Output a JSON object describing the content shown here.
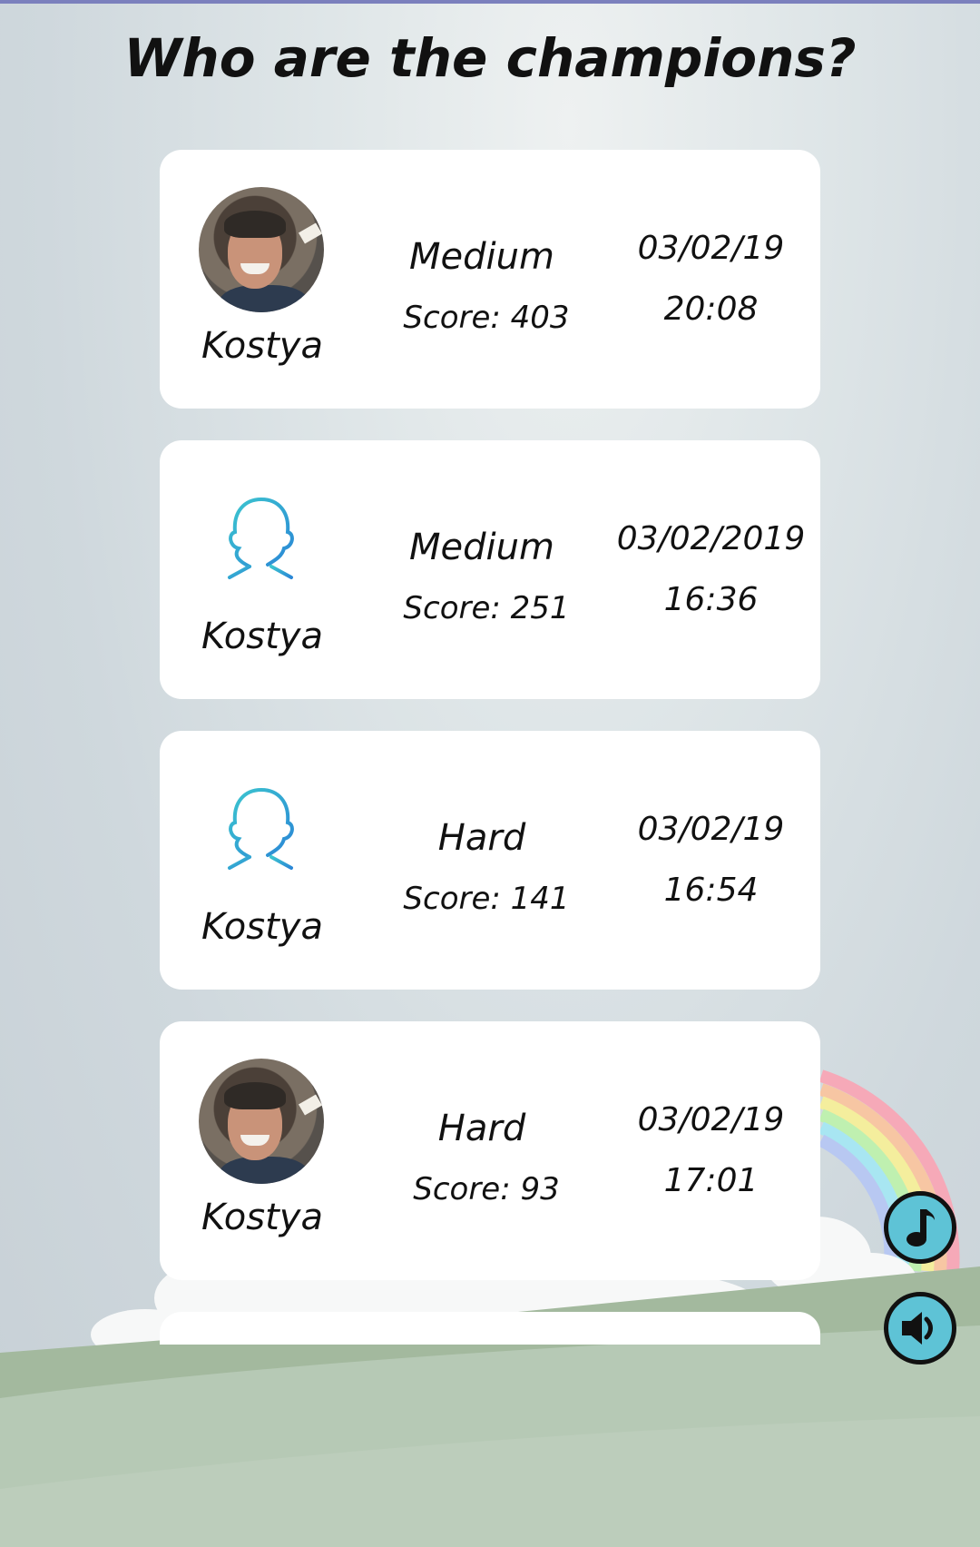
{
  "title": "Who are the champions?",
  "entries": [
    {
      "name": "Kostya",
      "avatar": "photo",
      "level": "Medium",
      "score": "Score: 403",
      "date": "03/02/19",
      "time": "20:08"
    },
    {
      "name": "Kostya",
      "avatar": "default-user-icon",
      "level": "Medium",
      "score": "Score: 251",
      "date": "03/02/2019",
      "time": "16:36"
    },
    {
      "name": "Kostya",
      "avatar": "default-user-icon",
      "level": "Hard",
      "score": "Score: 141",
      "date": "03/02/19",
      "time": "16:54"
    },
    {
      "name": "Kostya",
      "avatar": "photo",
      "level": "Hard",
      "score": "Score: 93",
      "date": "03/02/19",
      "time": "17:01"
    }
  ],
  "controls": {
    "music_icon": "music-note-icon",
    "sound_icon": "speaker-icon"
  },
  "colors": {
    "top_strip": "#7b80bd",
    "button_fill": "#5ec3d6",
    "user_icon": "#29a9d1",
    "hill_front": "#b6c9b5",
    "hill_back": "#a3b99e"
  }
}
